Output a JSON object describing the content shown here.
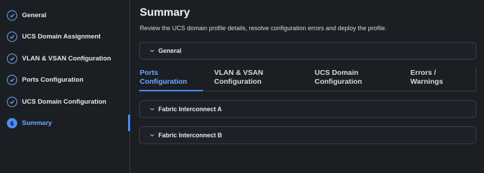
{
  "sidebar": {
    "steps": [
      {
        "label": "General",
        "status": "done"
      },
      {
        "label": "UCS Domain Assignment",
        "status": "done"
      },
      {
        "label": "VLAN & VSAN Configuration",
        "status": "done"
      },
      {
        "label": "Ports Configuration",
        "status": "done"
      },
      {
        "label": "UCS Domain Configuration",
        "status": "done"
      },
      {
        "label": "Summary",
        "status": "active",
        "number": "6"
      }
    ]
  },
  "main": {
    "title": "Summary",
    "subtitle": "Review the UCS domain profile details, resolve configuration errors and deploy the profile.",
    "general_panel": "General",
    "tabs": [
      {
        "line1": "Ports",
        "line2": "Configuration"
      },
      {
        "line1": "VLAN & VSAN",
        "line2": "Configuration"
      },
      {
        "line1": "UCS Domain",
        "line2": "Configuration"
      },
      {
        "line1": "Errors /",
        "line2": "Warnings"
      }
    ],
    "panels": [
      "Fabric Interconnect A",
      "Fabric Interconnect B"
    ]
  },
  "colors": {
    "background": "#1b1f24",
    "accent": "#4c8df6",
    "accent_text": "#6ea8ff",
    "border": "#3a3f46"
  }
}
